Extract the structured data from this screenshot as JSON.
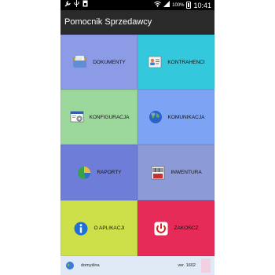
{
  "status_bar": {
    "battery": "100%",
    "time": "10:41",
    "icons": [
      "wrench-icon",
      "usb-icon",
      "sim-icon",
      "wifi-icon",
      "signal-icon",
      "battery-icon"
    ]
  },
  "app": {
    "title": "Pomocnik Sprzedawcy"
  },
  "tiles": [
    {
      "label": "DOKUMENTY",
      "color": "#8c9be6",
      "icon": "documents-icon"
    },
    {
      "label": "KONTRAHENCI",
      "color": "#34c8dc",
      "icon": "contacts-icon"
    },
    {
      "label": "KONFIGURACJA",
      "color": "#9cd89c",
      "icon": "settings-window-icon"
    },
    {
      "label": "KOMUNIKACJA",
      "color": "#7da4f4",
      "icon": "globe-icon"
    },
    {
      "label": "RAPORTY",
      "color": "#6e7ed8",
      "icon": "pie-chart-icon"
    },
    {
      "label": "INWENTURA",
      "color": "#8d9ad8",
      "icon": "inventory-icon"
    },
    {
      "label": "O APLIKACJI",
      "color": "#cde04a",
      "icon": "info-icon"
    },
    {
      "label": "ZAKOŃCZ",
      "color": "#e62b58",
      "icon": "power-icon"
    }
  ],
  "footer": {
    "profile": "domyślna",
    "version": "ver. 1602"
  }
}
